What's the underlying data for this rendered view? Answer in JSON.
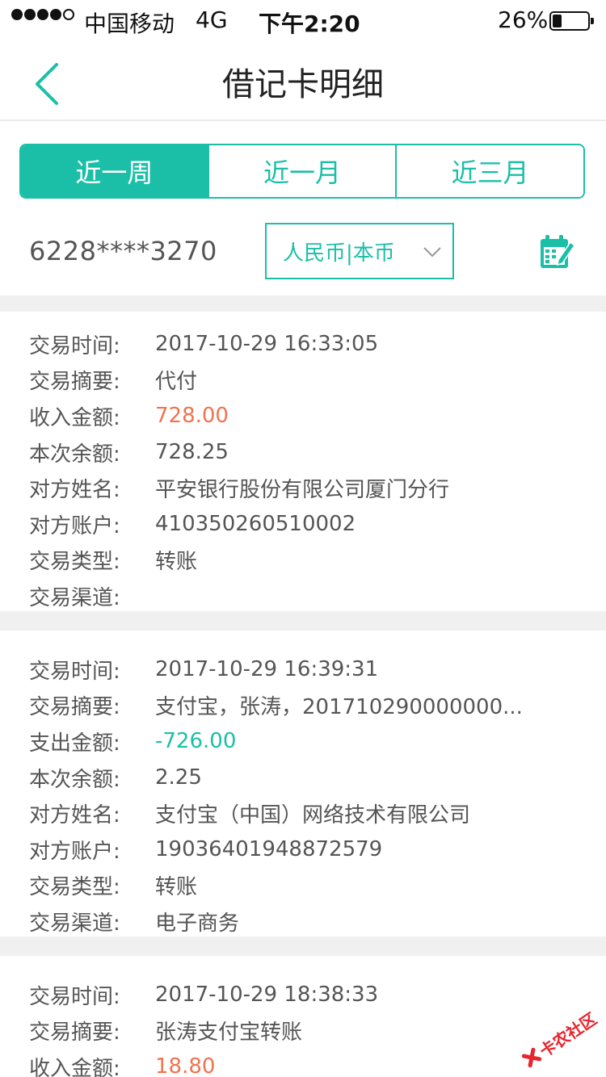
{
  "status_bar": {
    "carrier": "中国移动",
    "network": "4G",
    "time": "下午2:20",
    "battery": "26%",
    "battery_icon": "battery-icon"
  },
  "nav": {
    "title": "借记卡明细",
    "back_icon": "chevron-left-icon"
  },
  "tabs": [
    {
      "label": "近一周",
      "active": true
    },
    {
      "label": "近一月",
      "active": false
    },
    {
      "label": "近三月",
      "active": false
    }
  ],
  "filter": {
    "card_number": "6228****3270",
    "currency": "人民币|本币",
    "currency_icon": "chevron-down-icon",
    "calendar_icon": "calendar-edit-icon"
  },
  "records": [
    {
      "rows": [
        {
          "label": "交易时间:",
          "value": "2017-10-29 16:33:05"
        },
        {
          "label": "交易摘要:",
          "value": "代付"
        },
        {
          "label": "收入金额:",
          "value": "728.00",
          "kind": "income"
        },
        {
          "label": "本次余额:",
          "value": "728.25"
        },
        {
          "label": "对方姓名:",
          "value": "平安银行股份有限公司厦门分行"
        },
        {
          "label": "对方账户:",
          "value": "410350260510002"
        },
        {
          "label": "交易类型:",
          "value": "转账"
        },
        {
          "label": "交易渠道:",
          "value": ""
        }
      ]
    },
    {
      "rows": [
        {
          "label": "交易时间:",
          "value": "2017-10-29 16:39:31"
        },
        {
          "label": "交易摘要:",
          "value": "支付宝，张涛，201710290000000..."
        },
        {
          "label": "支出金额:",
          "value": "-726.00",
          "kind": "expense"
        },
        {
          "label": "本次余额:",
          "value": "2.25"
        },
        {
          "label": "对方姓名:",
          "value": "支付宝（中国）网络技术有限公司"
        },
        {
          "label": "对方账户:",
          "value": "19036401948872579"
        },
        {
          "label": "交易类型:",
          "value": "转账"
        },
        {
          "label": "交易渠道:",
          "value": "电子商务"
        }
      ]
    },
    {
      "rows": [
        {
          "label": "交易时间:",
          "value": "2017-10-29 18:38:33"
        },
        {
          "label": "交易摘要:",
          "value": "张涛支付宝转账"
        },
        {
          "label": "收入金额:",
          "value": "18.80",
          "kind": "income"
        }
      ]
    }
  ],
  "watermark": {
    "text": "卡农社区",
    "icon": "kanong-logo-icon"
  },
  "colors": {
    "accent": "#1bbfa7",
    "income": "#f0734f",
    "watermark": "#e8242c"
  }
}
